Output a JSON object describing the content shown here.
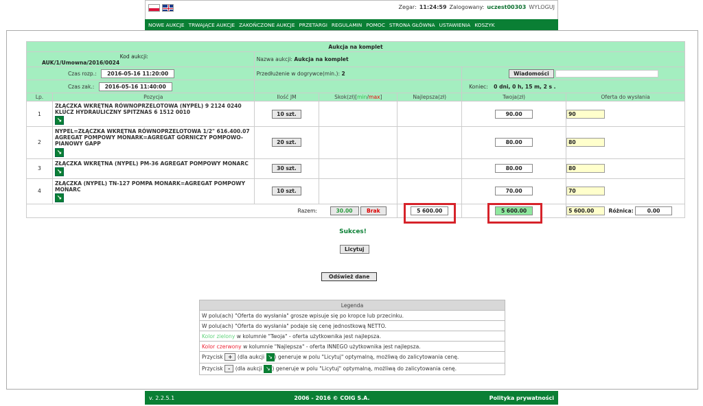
{
  "header": {
    "clock_label": "Zegar:",
    "clock_value": "11:24:59",
    "logged_label": "Zalogowany:",
    "username": "uczest00303",
    "logout": "WYLOGUJ"
  },
  "nav": [
    "NOWE AUKCJE",
    "TRWAJĄCE AUKCJE",
    "ZAKOŃCZONE AUKCJE",
    "PRZETARGI",
    "REGULAMIN",
    "POMOC",
    "STRONA GŁÓWNA",
    "USTAWIENIA",
    "KOSZYK"
  ],
  "auction": {
    "title": "Aukcja na komplet",
    "code_label": "Kod aukcji:",
    "code_value": "AUK/1/Umowna/2016/0024",
    "name_label": "Nazwa aukcji:",
    "name_value": "Aukcja na komplet",
    "start_label": "Czas rozp.:",
    "start_value": "2016-05-16 11:20:00",
    "ext_label": "Przedłużenie w dogrywce(min.):",
    "ext_value": "2",
    "messages_btn": "Wiadomości",
    "end_label": "Czas zak.:",
    "end_value": "2016-05-16 11:40:00",
    "remaining_label": "Koniec:",
    "remaining_value": "0 dni, 0 h, 15 m, 2 s ."
  },
  "columns": {
    "lp": "Lp.",
    "pos": "Pozycja",
    "qty": "Ilość JM",
    "skok": "Skok(zł)[",
    "min": "min",
    "slash": "/",
    "max": "max",
    "skok_end": "]",
    "best": "Najlepsza(zł)",
    "yours": "Twoja(zł)",
    "offer": "Oferta do wysłania"
  },
  "rows": [
    {
      "lp": "1",
      "name": "ZŁĄCZKA WKRĘTNA RÓWNOPRZELOTOWA (NYPEL) 9 2124 0240 KLUCZ HYDRAULICZNY SPITZNAS 6 1512 0010",
      "qty": "10 szt.",
      "yours": "90.00",
      "offer": "90"
    },
    {
      "lp": "2",
      "name": "NYPEL=ZŁĄCZKA WKRĘTNA RÓWNOPRZELOTOWA 1/2\" 616.400.07 AGREGAT POMPOWY MONARK=AGREGAT GÓRNICZY POMPOWO-PIANOWY GAPP",
      "qty": "20 szt.",
      "yours": "80.00",
      "offer": "80"
    },
    {
      "lp": "3",
      "name": "ZŁĄCZKA WKRĘTNA (NYPEL) PM-36 AGREGAT POMPOWY MONARC",
      "qty": "30 szt.",
      "yours": "80.00",
      "offer": "80"
    },
    {
      "lp": "4",
      "name": "ZŁĄCZKA (NYPEL) TN-127 POMPA MONARK=AGREGAT POMPOWY MONARC",
      "qty": "10 szt.",
      "yours": "70.00",
      "offer": "70"
    }
  ],
  "totals": {
    "label": "Razem:",
    "skok_min": "30.00",
    "skok_max": "Brak",
    "best": "5 600.00",
    "yours": "5 600.00",
    "offer": "5 600.00",
    "diff_label": "Różnica:",
    "diff_value": "0.00"
  },
  "status": "Sukces!",
  "bid_btn": "Licytuj",
  "refresh_btn": "Odśwież dane",
  "legend": {
    "title": "Legenda",
    "l1": "W polu(ach) \"Oferta do wysłania\" grosze wpisuje się po kropce lub przecinku.",
    "l2": "W polu(ach) \"Oferta do wysłania\" podaje się cenę jednostkową NETTO.",
    "l3_color": "Kolor zielony",
    "l3_rest": " w kolumnie \"Twoja\" - oferta użytkownika jest najlepsza.",
    "l4_color": "Kolor czerwony",
    "l4_rest": " w kolumnie \"Najlepsza\" - oferta INNEGO użytkownika jest najlepsza.",
    "l5a": "Przycisk",
    "l5btn": "+",
    "l5b": "(dla aukcji",
    "l5c": ") generuje w polu \"Licytuj\" optymalną, możliwą do zalicytowania cenę.",
    "l6a": "Przycisk",
    "l6btn": "-",
    "l6b": "(dla aukcji",
    "l6c": ") generuje w polu \"Licytuj\" optymalną, możliwą do zalicytowania cenę."
  },
  "footer": {
    "version": "v. 2.2.5.1",
    "copyright": "2006 - 2016 © COIG S.A.",
    "privacy": "Polityka prywatności"
  },
  "colors": {
    "accent": "#0a7f34",
    "table_bg": "#a4eec0",
    "highlight": "#d6232a"
  }
}
